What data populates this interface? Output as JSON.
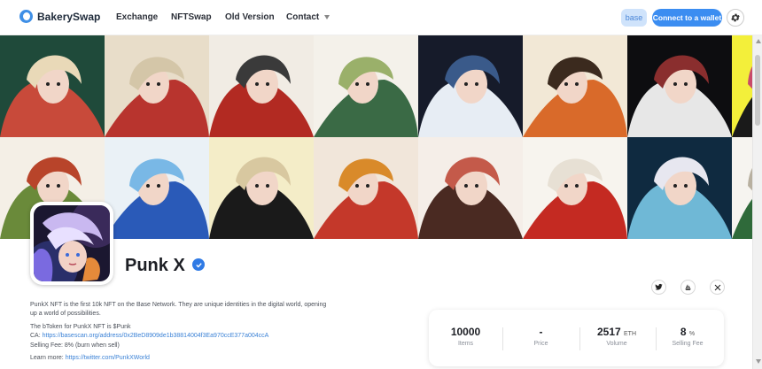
{
  "brand": {
    "name": "BakerySwap",
    "accent": "#3b8df1"
  },
  "nav": {
    "exchange": "Exchange",
    "nftswap": "NFTSwap",
    "old_version": "Old Version",
    "contact": "Contact"
  },
  "header_actions": {
    "network": "base",
    "connect": "Connect to a wallet",
    "settings_icon": "gear-icon"
  },
  "banner": {
    "tile_palettes": [
      [
        "#1f4a3a",
        "#c84a3a",
        "#e9d9b8"
      ],
      [
        "#e8ddc9",
        "#b8342e",
        "#d4c6a8"
      ],
      [
        "#f1ece4",
        "#b22a22",
        "#3a3a3a"
      ],
      [
        "#f4f1ea",
        "#3a6a45",
        "#9ab06a"
      ],
      [
        "#161b2a",
        "#e7edf4",
        "#3a5a8a"
      ],
      [
        "#f2e8d6",
        "#d96a2a",
        "#3b2a1e"
      ],
      [
        "#0d0d10",
        "#e7e7e7",
        "#8a2e2e"
      ],
      [
        "#f3ef3a",
        "#1a1a1a",
        "#c84a6a"
      ],
      [
        "#f4efe6",
        "#6a8a3a",
        "#b8442a"
      ],
      [
        "#eaf1f6",
        "#2a5ab8",
        "#79b8e6"
      ],
      [
        "#f4edc8",
        "#1a1a1a",
        "#d8c8a0"
      ],
      [
        "#f1e6da",
        "#c4382a",
        "#d98a2a"
      ],
      [
        "#f5eee8",
        "#4a2a22",
        "#c45a4a"
      ],
      [
        "#f7f4ee",
        "#c42a22",
        "#e7e0d4"
      ],
      [
        "#0f2a40",
        "#6fb8d6",
        "#e7e7f0"
      ],
      [
        "#f6f4f0",
        "#2f6a3a",
        "#b8b0a0"
      ],
      [
        "#2a2f8a",
        "#c84aa8",
        "#e6b8d6"
      ]
    ]
  },
  "collection": {
    "title": "Punk X",
    "verified_icon": "verified-badge-icon",
    "description": "PunkX NFT is the first 10k NFT on the Base Network. They are unique identities in the digital world, opening up a world of possibilities.",
    "btoken_line": "The bToken for PunkX NFT is $Punk",
    "ca_label": "CA:",
    "ca_link": "https://basescan.org/address/0x2BeD8909de1b38814004f3Ea970ccE377a004ccA",
    "fee_line": "Selling Fee: 8% (burn when sell)",
    "learn_label": "Learn more:",
    "learn_link": "https://twitter.com/PunkXWorld"
  },
  "social": {
    "twitter_icon": "twitter-icon",
    "market_icon": "boat-icon",
    "x_icon": "x-icon"
  },
  "stats": {
    "items_value": "10000",
    "items_label": "Items",
    "price_value": "-",
    "price_label": "Price",
    "volume_value": "2517",
    "volume_unit": "ETH",
    "volume_label": "Volume",
    "fee_value": "8",
    "fee_unit": "%",
    "fee_label": "Selling Fee"
  }
}
